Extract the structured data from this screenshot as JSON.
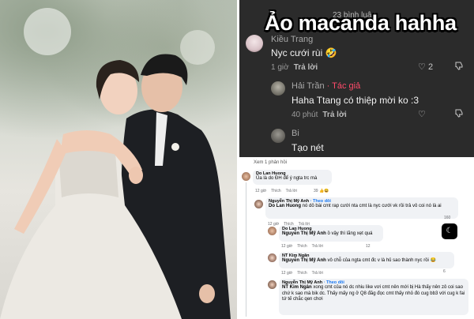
{
  "tiktok": {
    "comment_count": "23 bình luận",
    "headline": "Ảo macanda hahha",
    "comments": [
      {
        "name": "Kiều Trang",
        "text": "Nyc cưới rùi",
        "emoji": "🤣",
        "time": "1 giờ",
        "reply": "Trả lời",
        "likes": "2",
        "like_icon": "heart-outline",
        "dislike_icon": "thumbs-down"
      },
      {
        "name": "Hải Trần",
        "author_badge": "· Tác giả",
        "text": "Haha Ttang có thiệp mời ko :3",
        "time": "40 phút",
        "reply": "Trả lời"
      },
      {
        "name": "Bi",
        "text": "Tạo nét"
      }
    ]
  },
  "facebook": {
    "see_replies": "Xem 1 phản hồi",
    "comments": [
      {
        "name": "Do Lan Huong",
        "text": "Ủa là do ĐH để ý ngta trc mà",
        "time": "12 giờ",
        "like": "Thích",
        "reply": "Trả lời",
        "reactions": "39"
      },
      {
        "name": "Nguyễn Thị Mỹ Anh",
        "follow": "· Theo dõi",
        "mention": "Do Lan Huong",
        "text": "nó dô bài cmt rap cưới nta cmt là nyc cưới vk rồi trả vô coi nó là ai",
        "time": "12 giờ",
        "like": "Thích",
        "reply": "Trả lời",
        "reactions": "160"
      },
      {
        "name": "Do Lan Huong",
        "mention": "Nguyễn Thị Mỹ Anh",
        "text": "ồ vậy thì lãng xẹt quá",
        "time": "12 giờ",
        "like": "Thích",
        "reply": "Trả lời",
        "reactions": "12"
      },
      {
        "name": "NT Kim Ngân",
        "mention": "Nguyễn Thị Mỹ Anh",
        "text": "vô chỗ của ngta cmt đc v là hủ sao thành nyc rồi",
        "time": "12 giờ",
        "like": "Thích",
        "reply": "Trả lời",
        "reactions": "6"
      },
      {
        "name": "Nguyễn Thị Mỹ Anh",
        "follow": "· Theo dõi",
        "mention": "NT Kim Ngân",
        "text": "xong cmt của nó dc nhiu like vơi cmt nên mới bị Hà thấy nên zô coi sao chứ k sao mà bik dc. Thấy mấy ng ở Q8 đăg đọc cmt thấy nhỏ đó cug bb3 với cug k fai tứ tế chắc qen chơi",
        "reactions": ""
      }
    ],
    "reaction_icons": "👍😆"
  },
  "colors": {
    "tiktok_bg": "#2b2b2b",
    "author_accent": "#ff4b6a",
    "fb_follow": "#1877f2",
    "fb_bubble": "#f0f2f5"
  }
}
